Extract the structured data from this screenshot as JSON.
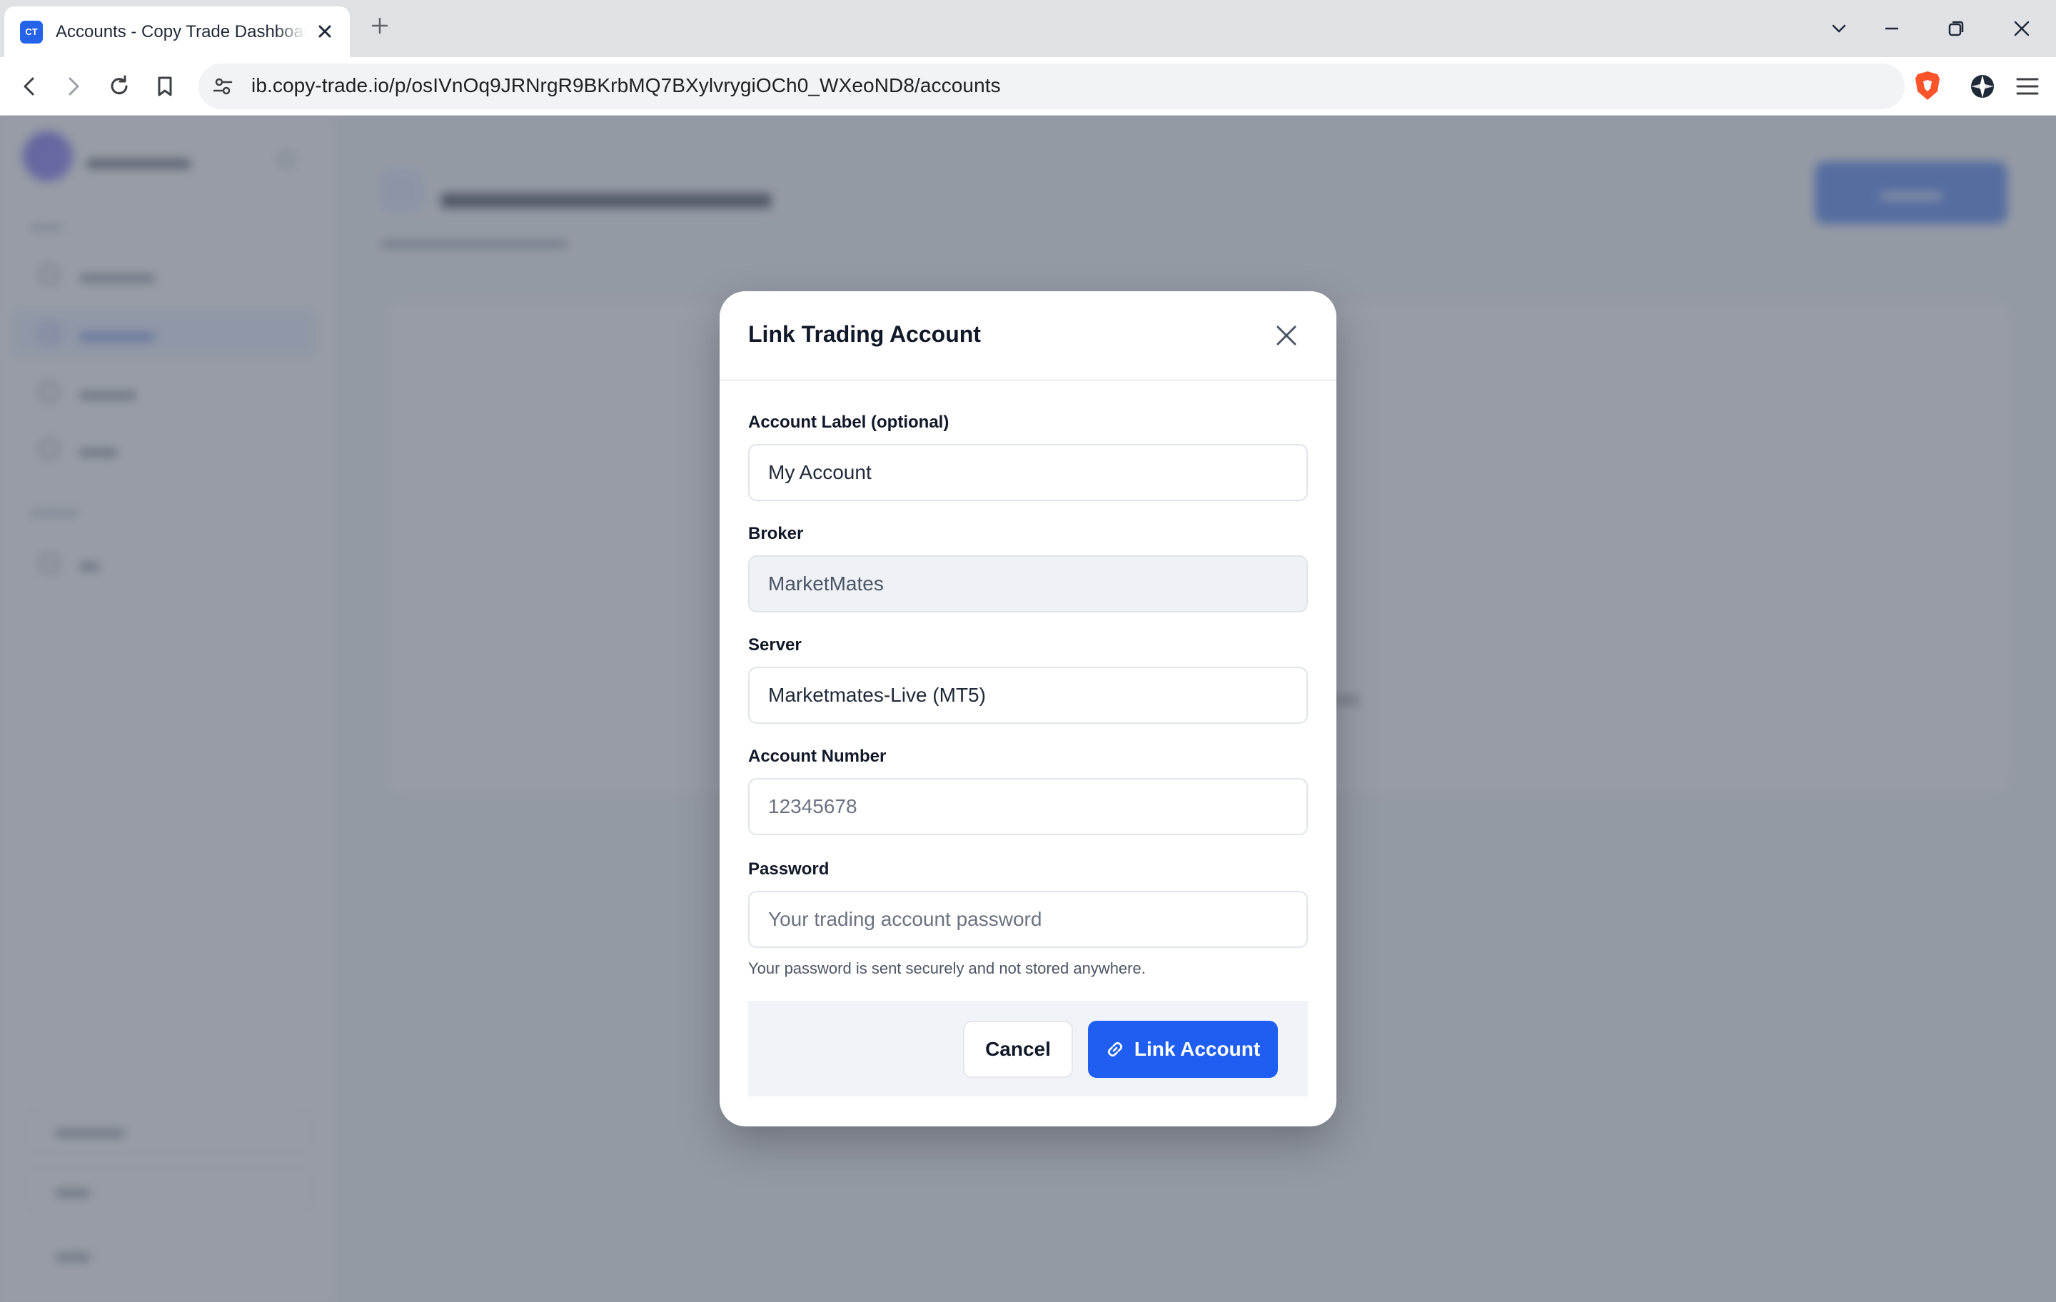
{
  "browser": {
    "tab": {
      "favicon_text": "CT",
      "title": "Accounts - Copy Trade Dashboard"
    },
    "url": "ib.copy-trade.io/p/osIVnOq9JRNrgR9BKrbMQ7BXylvrygiOCh0_WXeoND8/accounts"
  },
  "modal": {
    "title": "Link Trading Account",
    "fields": {
      "label": {
        "label": "Account Label (optional)",
        "value": "My Account"
      },
      "broker": {
        "label": "Broker",
        "value": "MarketMates"
      },
      "server": {
        "label": "Server",
        "value": "Marketmates-Live (MT5)"
      },
      "account_number": {
        "label": "Account Number",
        "placeholder": "12345678"
      },
      "password": {
        "label": "Password",
        "placeholder": "Your trading account password",
        "hint": "Your password is sent securely and not stored anywhere."
      }
    },
    "buttons": {
      "cancel": "Cancel",
      "submit": "Link Account"
    },
    "accent_color": "#1f5ef0"
  }
}
